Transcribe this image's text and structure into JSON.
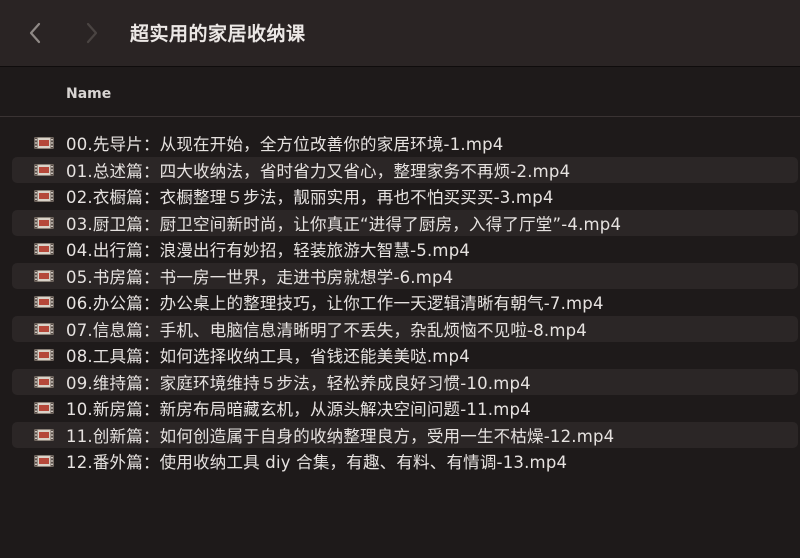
{
  "window": {
    "title": "超实用的家居收纳课"
  },
  "toolbar": {
    "back_icon": "chevron-left-icon",
    "forward_icon": "chevron-right-icon"
  },
  "columns": {
    "name": "Name"
  },
  "colors": {
    "background": "#1e1a1a",
    "toolbar": "#2a2424",
    "row_alt": "#2b2626",
    "text": "#e6e2e0"
  },
  "files": [
    {
      "name": "00.先导片：从现在开始，全方位改善你的家居环境-1.mp4",
      "icon": "video-file-icon"
    },
    {
      "name": "01.总述篇：四大收纳法，省时省力又省心，整理家务不再烦-2.mp4",
      "icon": "video-file-icon"
    },
    {
      "name": "02.衣橱篇：衣橱整理５步法，靓丽实用，再也不怕买买买-3.mp4",
      "icon": "video-file-icon"
    },
    {
      "name": "03.厨卫篇：厨卫空间新时尚，让你真正“进得了厨房，入得了厅堂”-4.mp4",
      "icon": "video-file-icon"
    },
    {
      "name": "04.出行篇：浪漫出行有妙招，轻装旅游大智慧-5.mp4",
      "icon": "video-file-icon"
    },
    {
      "name": "05.书房篇：书一房一世界，走进书房就想学-6.mp4",
      "icon": "video-file-icon"
    },
    {
      "name": "06.办公篇：办公桌上的整理技巧，让你工作一天逻辑清晰有朝气-7.mp4",
      "icon": "video-file-icon"
    },
    {
      "name": "07.信息篇：手机、电脑信息清晰明了不丢失，杂乱烦恼不见啦-8.mp4",
      "icon": "video-file-icon"
    },
    {
      "name": "08.工具篇：如何选择收纳工具，省钱还能美美哒.mp4",
      "icon": "video-file-icon"
    },
    {
      "name": "09.维持篇：家庭环境维持５步法，轻松养成良好习惯-10.mp4",
      "icon": "video-file-icon"
    },
    {
      "name": "10.新房篇：新房布局暗藏玄机，从源头解决空间问题-11.mp4",
      "icon": "video-file-icon"
    },
    {
      "name": "11.创新篇：如何创造属于自身的收纳整理良方，受用一生不枯燥-12.mp4",
      "icon": "video-file-icon"
    },
    {
      "name": "12.番外篇：使用收纳工具 diy 合集，有趣、有料、有情调-13.mp4",
      "icon": "video-file-icon"
    }
  ]
}
